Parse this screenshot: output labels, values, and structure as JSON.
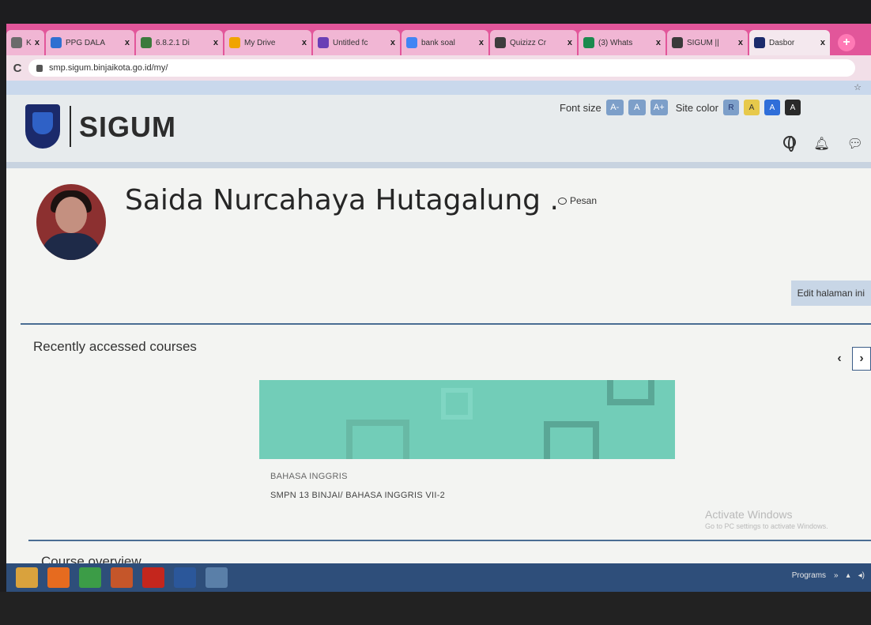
{
  "browser": {
    "tabs": [
      {
        "label": "KB E",
        "icon_color": "#6b6b6b",
        "icon": "doc-icon"
      },
      {
        "label": "PPG DALA",
        "icon_color": "#2f6fd1",
        "icon": "globe-icon"
      },
      {
        "label": "6.8.2.1 Di",
        "icon_color": "#3c7a3c",
        "icon": "slides-icon"
      },
      {
        "label": "My Drive",
        "icon_color": "#f0a400",
        "icon": "drive-icon"
      },
      {
        "label": "Untitled fc",
        "icon_color": "#6a3fb5",
        "icon": "form-icon"
      },
      {
        "label": "bank soal",
        "icon_color": "#4285f4",
        "icon": "google-icon"
      },
      {
        "label": "Quizizz Cr",
        "icon_color": "#3d3d3d",
        "icon": "quizizz-icon"
      },
      {
        "label": "(3) Whats",
        "icon_color": "#1b8a4e",
        "icon": "whatsapp-icon"
      },
      {
        "label": "SIGUM ||",
        "icon_color": "#3a3a3a",
        "icon": "globe-icon"
      },
      {
        "label": "Dasbor",
        "icon_color": "#1b2a6b",
        "icon": "shield-icon"
      }
    ],
    "tab_close": "x",
    "new_tab": "+",
    "url": "smp.sigum.binjaikota.go.id/my/"
  },
  "header": {
    "brand": "SIGUM",
    "font_size_label": "Font size",
    "font_buttons": [
      "A-",
      "A",
      "A+"
    ],
    "site_color_label": "Site color",
    "color_buttons": [
      {
        "label": "R",
        "bg": "#7d9fc9",
        "fg": "#1d2f6b"
      },
      {
        "label": "A",
        "bg": "#e7c94b",
        "fg": "#333"
      },
      {
        "label": "A",
        "bg": "#2f6ed9",
        "fg": "#fff"
      },
      {
        "label": "A",
        "bg": "#2a2a2a",
        "fg": "#fff"
      }
    ]
  },
  "profile": {
    "name": "Saida Nurcahaya Hutagalung .",
    "message_label": "Pesan",
    "edit_button": "Edit halaman ini"
  },
  "recent": {
    "title": "Recently accessed courses",
    "prev": "‹",
    "next": "›",
    "course": {
      "category": "BAHASA INGGRIS",
      "name": "SMPN 13 BINJAI/ BAHASA INGGRIS VII-2"
    }
  },
  "watermark": {
    "line1": "Activate Windows",
    "line2": "Go to PC settings to activate Windows."
  },
  "overview": {
    "title": "Course overview"
  },
  "taskbar": {
    "programs_label": "Programs",
    "apps": [
      {
        "name": "file-explorer-icon",
        "color": "#d9a23d"
      },
      {
        "name": "firefox-icon",
        "color": "#e66b1f"
      },
      {
        "name": "chrome-icon",
        "color": "#3c9c47"
      },
      {
        "name": "outlook-icon",
        "color": "#c5562a"
      },
      {
        "name": "acrobat-icon",
        "color": "#c4261d"
      },
      {
        "name": "word-icon",
        "color": "#2b579a"
      },
      {
        "name": "app-icon",
        "color": "#5a7fa8"
      }
    ]
  },
  "colors": {
    "tabstrip": "#e2569a",
    "accent_line": "#4a6d93",
    "course_card": "#72cdb8"
  }
}
